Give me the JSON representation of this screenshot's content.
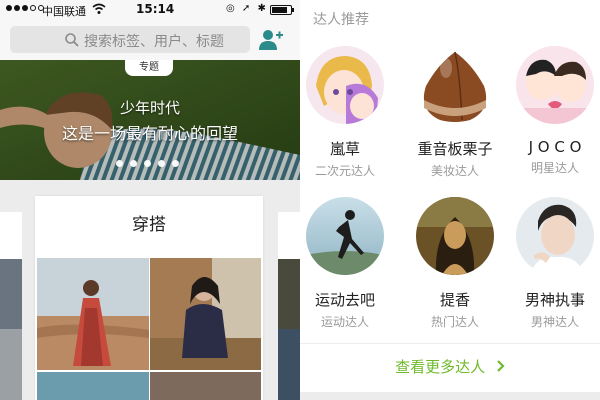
{
  "status_bar": {
    "carrier": "中国联通",
    "time": "15:14",
    "battery_level": 0.85
  },
  "search": {
    "placeholder": "搜索标签、用户、标题"
  },
  "icons": {
    "search": "search-icon",
    "add_user": "add-user-icon",
    "wifi": "wifi-icon",
    "chevron": "chevron-right-icon"
  },
  "banner": {
    "tag": "专题",
    "title": "少年时代",
    "subtitle": "这是一场最有耐心的回望",
    "slide_count": 5
  },
  "card": {
    "title": "穿搭"
  },
  "experts": {
    "header": "达人推荐",
    "items": [
      {
        "name": "嵐草",
        "category": "二次元达人",
        "avatar_color": "#f3d5e2"
      },
      {
        "name": "重音板栗子",
        "category": "美妆达人",
        "avatar_color": "#8a4a22"
      },
      {
        "name": "J O C O",
        "category": "明星达人",
        "avatar_color": "#f4c6d4"
      },
      {
        "name": "运动去吧",
        "category": "运动达人",
        "avatar_color": "#9fc4d8"
      },
      {
        "name": "提香",
        "category": "热门达人",
        "avatar_color": "#6b5226"
      },
      {
        "name": "男神执事",
        "category": "男神达人",
        "avatar_color": "#dfe6ea"
      }
    ],
    "more_label": "查看更多达人"
  },
  "colors": {
    "accent": "#6fba2c",
    "muted_text": "#9a9a9a"
  }
}
